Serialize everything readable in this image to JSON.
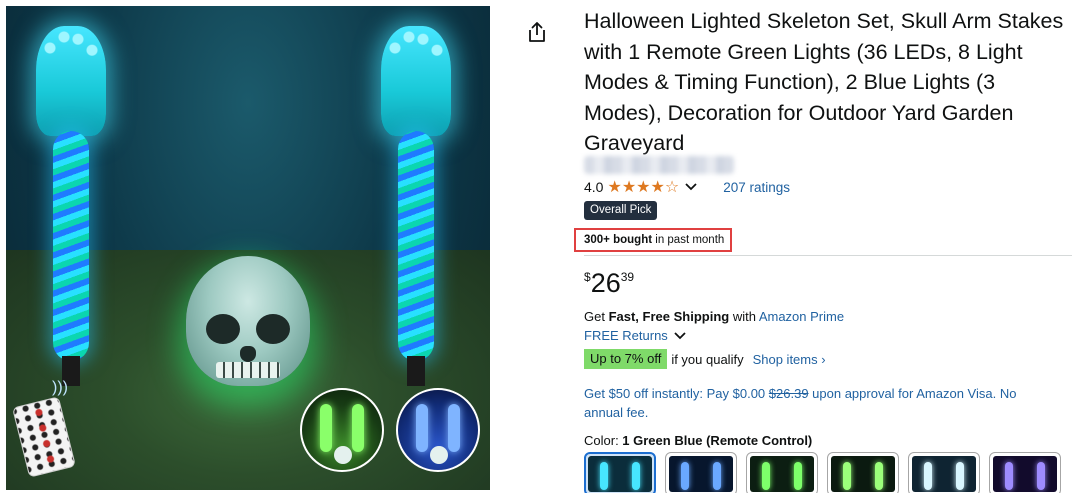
{
  "product": {
    "title": "Halloween Lighted Skeleton Set, Skull Arm Stakes with 1 Remote Green Lights (36 LEDs, 8 Light Modes & Timing Function), 2 Blue Lights (3 Modes), Decoration for Outdoor Yard Garden Graveyard",
    "rating": "4.0",
    "stars": "★★★★☆",
    "ratings_count": "207 ratings",
    "badge": "Overall Pick",
    "bought_bold": "300+ bought",
    "bought_rest": " in past month",
    "price": {
      "currency": "$",
      "whole": "26",
      "fraction": "39"
    }
  },
  "shipping": {
    "prefix": "Get ",
    "bold": "Fast, Free Shipping",
    "middle": " with ",
    "link": "Amazon Prime",
    "returns": "FREE Returns"
  },
  "promo": {
    "badge": "Up to 7% off",
    "qualify": "if you qualify",
    "shop_items": "Shop items ›"
  },
  "visa": {
    "before": "Get $50 off instantly: Pay $0.00 ",
    "strike": "$26.39",
    "after": " upon approval for Amazon Visa. No annual fee."
  },
  "color": {
    "label": "Color: ",
    "value": "1 Green Blue (Remote Control)"
  },
  "colors": {
    "title_text": "#0f1111",
    "link": "#2162a1",
    "star": "#de7921",
    "badge_bg": "#232f3e",
    "highlight_border": "#e04040",
    "promo_bg": "#7fda69"
  },
  "icons": {
    "share": "share-icon",
    "chevron": "chevron-down-icon"
  }
}
